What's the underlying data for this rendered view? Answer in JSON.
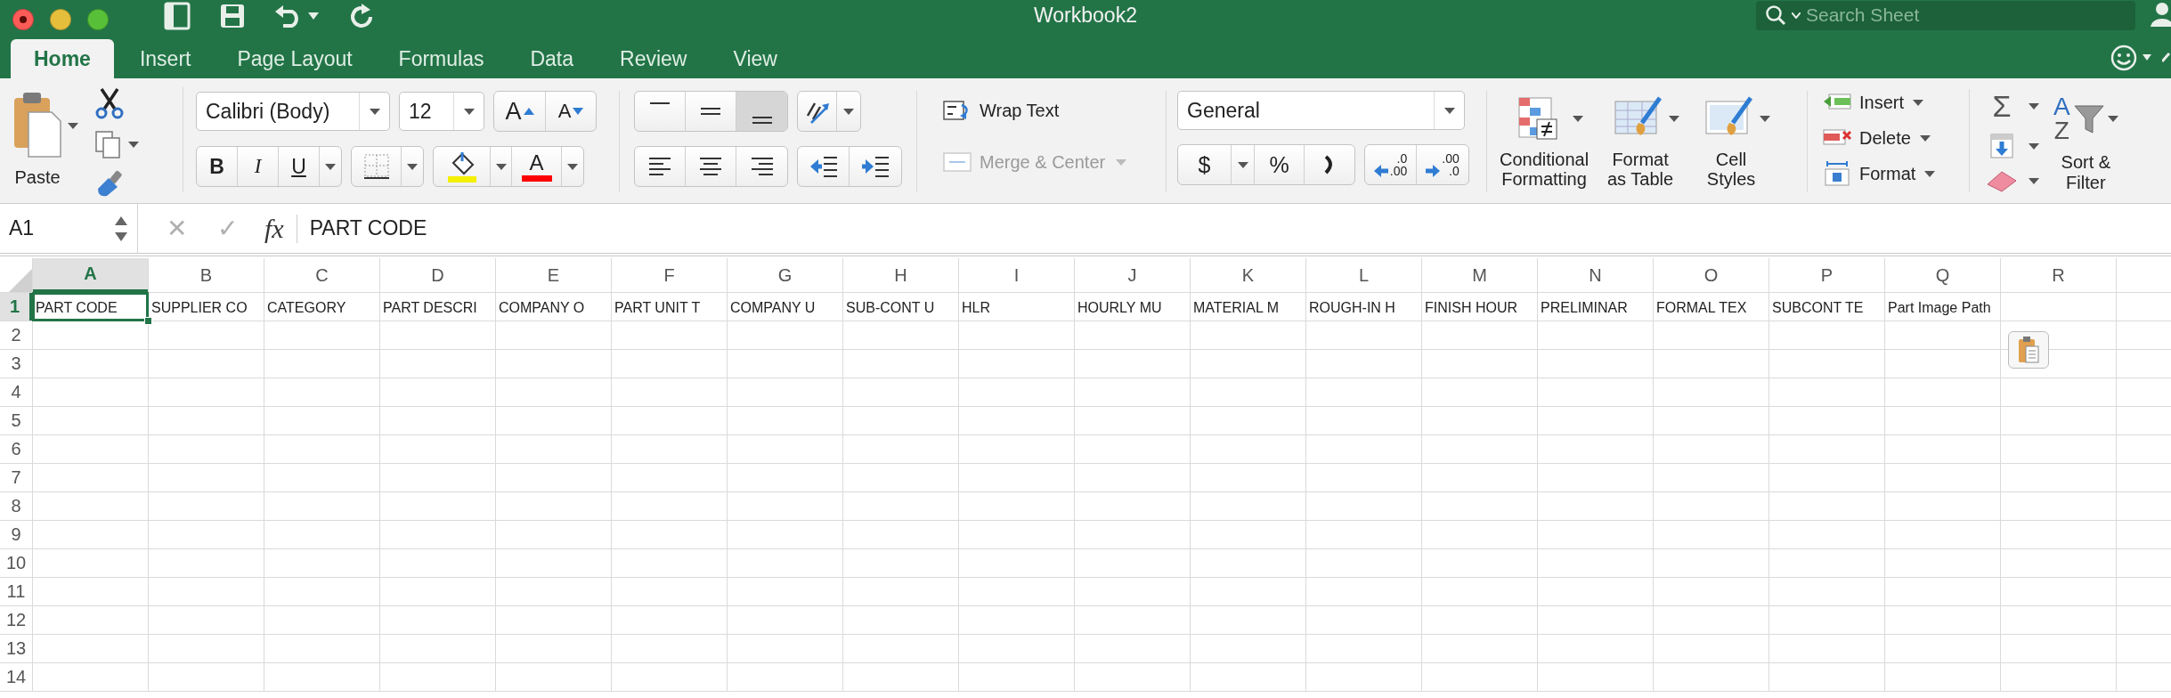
{
  "window": {
    "title": "Workbook2"
  },
  "search": {
    "placeholder": "Search Sheet"
  },
  "tabs": [
    {
      "label": "Home",
      "selected": true
    },
    {
      "label": "Insert",
      "selected": false
    },
    {
      "label": "Page Layout",
      "selected": false
    },
    {
      "label": "Formulas",
      "selected": false
    },
    {
      "label": "Data",
      "selected": false
    },
    {
      "label": "Review",
      "selected": false
    },
    {
      "label": "View",
      "selected": false
    }
  ],
  "ribbon": {
    "paste": {
      "label": "Paste"
    },
    "font": {
      "name": "Calibri (Body)",
      "size": "12",
      "grow": "A",
      "shrink": "A",
      "bold": "B",
      "italic": "I",
      "underline": "U",
      "font_color": "A"
    },
    "vertical_align": [
      {
        "kind": "top",
        "selected": false
      },
      {
        "kind": "middle",
        "selected": false
      },
      {
        "kind": "bottom",
        "selected": true
      }
    ],
    "horizontal_align": [
      {
        "kind": "left",
        "selected": false
      },
      {
        "kind": "center",
        "selected": false
      },
      {
        "kind": "right",
        "selected": false
      }
    ],
    "wrap_text": {
      "label": "Wrap Text"
    },
    "merge": {
      "label": "Merge & Center",
      "disabled": true
    },
    "number": {
      "format": "General",
      "currency": "$",
      "percent": "%"
    },
    "decimal_buttons": [
      {
        "kind": "increase",
        "lines": [
          ".0",
          ".00"
        ]
      },
      {
        "kind": "decrease",
        "lines": [
          ".00",
          ".0"
        ]
      }
    ],
    "styles": [
      {
        "kind": "conditional",
        "label": "Conditional\nFormatting"
      },
      {
        "kind": "table",
        "label": "Format\nas Table"
      },
      {
        "kind": "cell",
        "label": "Cell\nStyles"
      }
    ],
    "cells": [
      {
        "kind": "insert",
        "label": "Insert"
      },
      {
        "kind": "delete",
        "label": "Delete"
      },
      {
        "kind": "format",
        "label": "Format"
      }
    ],
    "editing": {
      "sum": "Σ",
      "sort_letters": [
        "A",
        "Z"
      ],
      "sort_label": "Sort &\nFilter"
    }
  },
  "formula_bar": {
    "name_box": "A1",
    "cancel": "✕",
    "enter": "✓",
    "function": "fx",
    "value": "PART CODE"
  },
  "sheet": {
    "columns": [
      {
        "label": "A",
        "selected": true
      },
      {
        "label": "B",
        "selected": false
      },
      {
        "label": "C",
        "selected": false
      },
      {
        "label": "D",
        "selected": false
      },
      {
        "label": "E",
        "selected": false
      },
      {
        "label": "F",
        "selected": false
      },
      {
        "label": "G",
        "selected": false
      },
      {
        "label": "H",
        "selected": false
      },
      {
        "label": "I",
        "selected": false
      },
      {
        "label": "J",
        "selected": false
      },
      {
        "label": "K",
        "selected": false
      },
      {
        "label": "L",
        "selected": false
      },
      {
        "label": "M",
        "selected": false
      },
      {
        "label": "N",
        "selected": false
      },
      {
        "label": "O",
        "selected": false
      },
      {
        "label": "P",
        "selected": false
      },
      {
        "label": "Q",
        "selected": false
      },
      {
        "label": "R",
        "selected": false
      }
    ],
    "rows": [
      {
        "label": "1",
        "selected": true,
        "cells": [
          "PART CODE",
          "SUPPLIER CO",
          "CATEGORY",
          "PART DESCRI",
          "COMPANY O",
          "PART UNIT T",
          "COMPANY U",
          "SUB-CONT U",
          "HLR",
          "HOURLY MU",
          "MATERIAL M",
          "ROUGH-IN H",
          "FINISH HOUR",
          "PRELIMINAR",
          "FORMAL TEX",
          "SUBCONT TE",
          "Part Image Path"
        ]
      },
      {
        "label": "2",
        "selected": false
      },
      {
        "label": "3",
        "selected": false
      },
      {
        "label": "4",
        "selected": false
      },
      {
        "label": "5",
        "selected": false
      },
      {
        "label": "6",
        "selected": false
      },
      {
        "label": "7",
        "selected": false
      },
      {
        "label": "8",
        "selected": false
      },
      {
        "label": "9",
        "selected": false
      },
      {
        "label": "10",
        "selected": false
      },
      {
        "label": "11",
        "selected": false
      },
      {
        "label": "12",
        "selected": false
      },
      {
        "label": "13",
        "selected": false
      },
      {
        "label": "14",
        "selected": false
      }
    ]
  }
}
